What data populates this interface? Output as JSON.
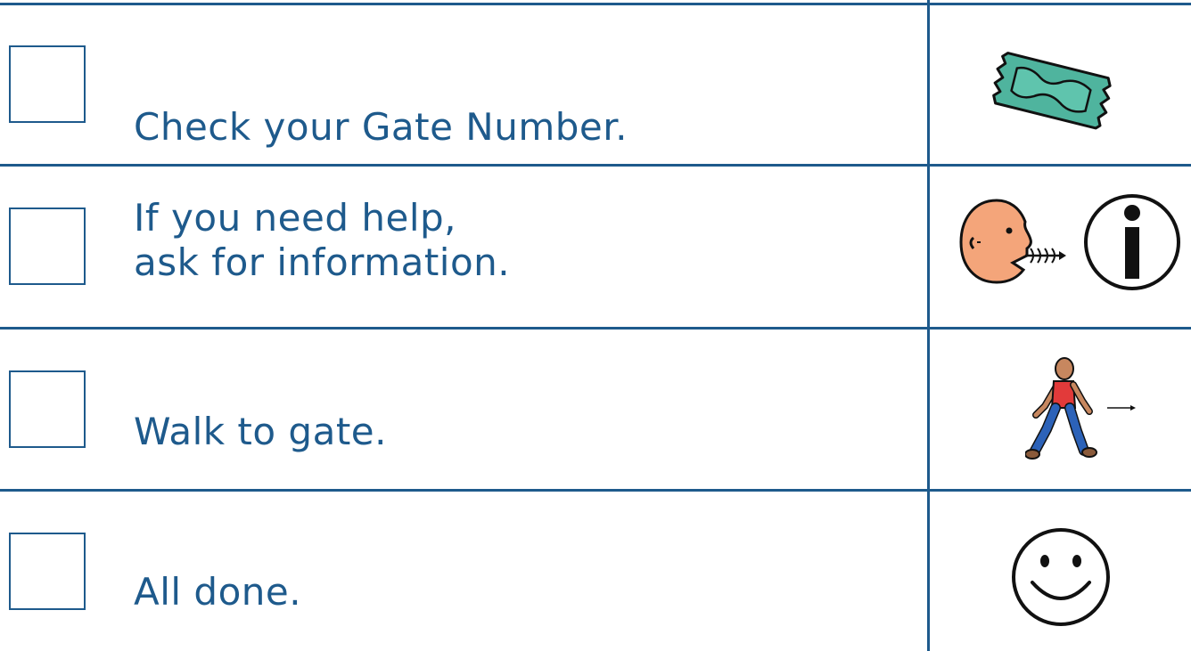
{
  "checklist": {
    "colors": {
      "accent": "#1e5a8c"
    },
    "items": [
      {
        "label": "Check your Gate Number.",
        "icon": "ticket-icon"
      },
      {
        "label": "If you need help,\nask for information.",
        "icon": "ask-information-icon"
      },
      {
        "label": "Walk to gate.",
        "icon": "walking-person-icon"
      },
      {
        "label": "All done.",
        "icon": "smiley-face-icon"
      }
    ]
  }
}
